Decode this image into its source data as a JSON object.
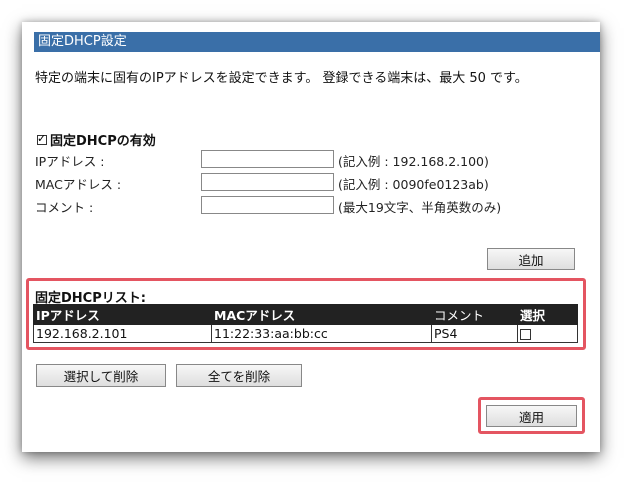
{
  "window": {
    "title": "固定DHCP設定"
  },
  "description": "特定の端末に固有のIPアドレスを設定できます。 登録できる端末は、最大 50 です。",
  "enable": {
    "label": "固定DHCPの有効",
    "checked": true
  },
  "fields": [
    {
      "label": "IPアドレス :",
      "value": "",
      "hint": "(記入例 : 192.168.2.100)"
    },
    {
      "label": "MACアドレス :",
      "value": "",
      "hint": "(記入例 : 0090fe0123ab)"
    },
    {
      "label": "コメント :",
      "value": "",
      "hint": "(最大19文字、半角英数のみ)"
    }
  ],
  "buttons": {
    "add": "追加",
    "delete_selected": "選択して削除",
    "delete_all": "全てを削除",
    "apply": "適用"
  },
  "list": {
    "title": "固定DHCPリスト:",
    "columns": [
      "IPアドレス",
      "MACアドレス",
      "コメント",
      "選択"
    ],
    "rows": [
      {
        "ip": "192.168.2.101",
        "mac": "11:22:33:aa:bb:cc",
        "comment": "PS4",
        "selected": false
      }
    ]
  },
  "colors": {
    "titlebar": "#3a6fa8",
    "table_header": "#222222",
    "highlight": "#e45561"
  }
}
